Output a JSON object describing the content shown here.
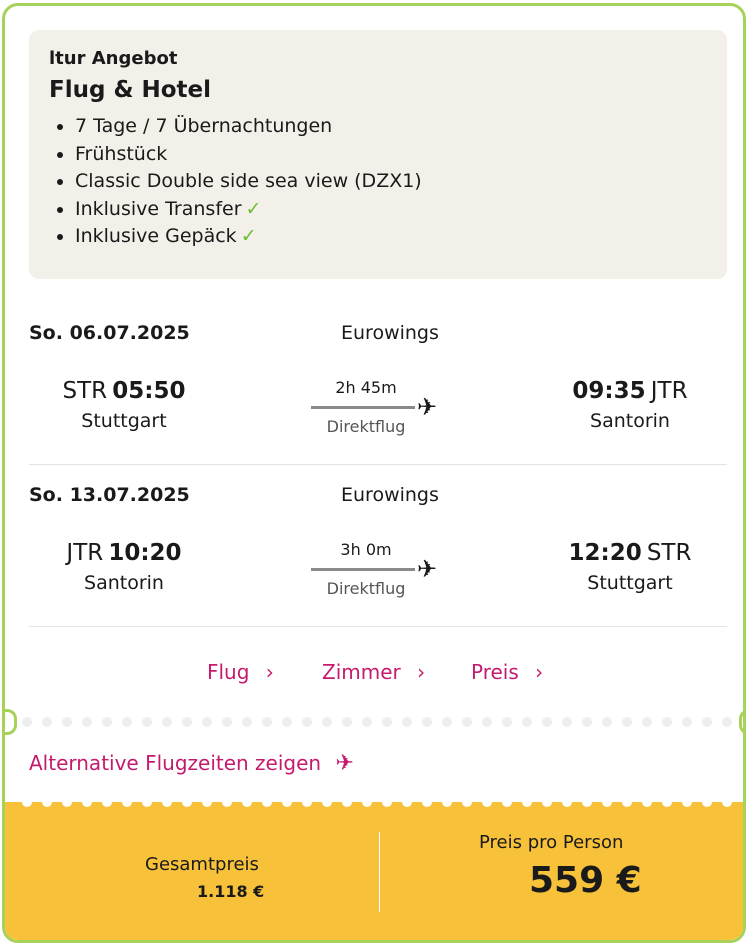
{
  "offer": {
    "label": "ltur Angebot",
    "title": "Flug & Hotel",
    "features": [
      "7 Tage / 7 Übernachtungen",
      "Frühstück",
      "Classic Double side sea view (DZX1)",
      "Inklusive Transfer",
      "Inklusive Gepäck"
    ],
    "check": "✓"
  },
  "flights": [
    {
      "date": "So. 06.07.2025",
      "airline": "Eurowings",
      "dep_code": "STR",
      "dep_time": "05:50",
      "dep_city": "Stuttgart",
      "duration": "2h 45m",
      "type": "Direktflug",
      "arr_time": "09:35",
      "arr_code": "JTR",
      "arr_city": "Santorin"
    },
    {
      "date": "So. 13.07.2025",
      "airline": "Eurowings",
      "dep_code": "JTR",
      "dep_time": "10:20",
      "dep_city": "Santorin",
      "duration": "3h 0m",
      "type": "Direktflug",
      "arr_time": "12:20",
      "arr_code": "STR",
      "arr_city": "Stuttgart"
    }
  ],
  "links": {
    "flug": "Flug",
    "zimmer": "Zimmer",
    "preis": "Preis",
    "chevron": "›",
    "alternative": "Alternative Flugzeiten zeigen"
  },
  "price": {
    "total_label": "Gesamtpreis",
    "total_value": "1.118 €",
    "per_person_label": "Preis pro Person",
    "per_person_value": "559 €"
  },
  "icons": [
    "check-icon",
    "plane-icon",
    "chevron-right-icon"
  ],
  "colors": {
    "accent": "#c51b6e",
    "border": "#a6d25a",
    "footer": "#f7c23a",
    "check": "#6cbf2e"
  }
}
